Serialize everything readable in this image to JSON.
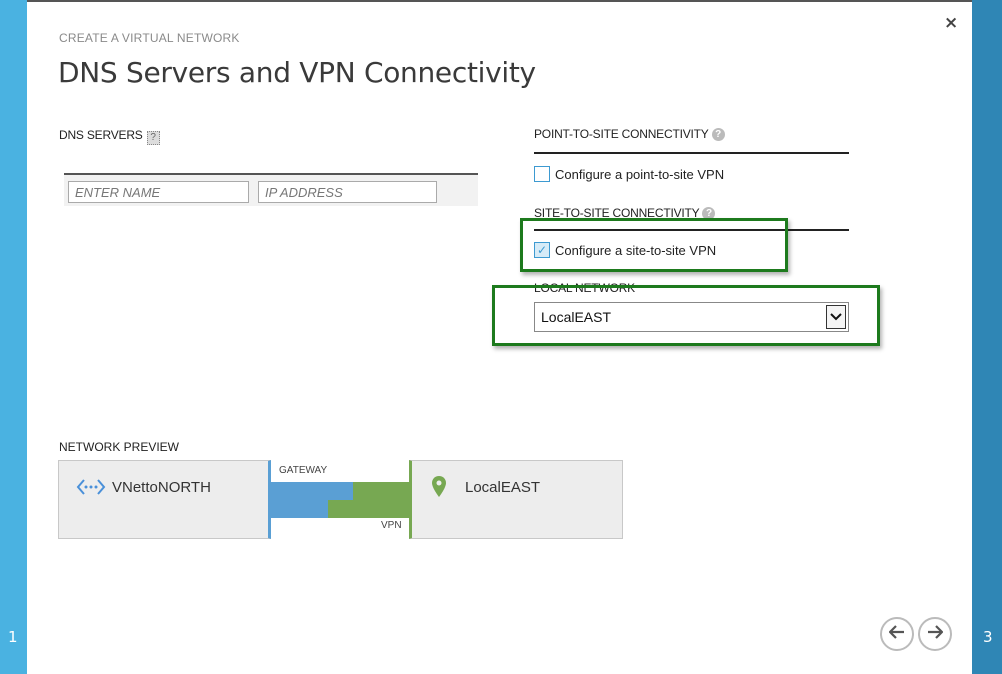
{
  "wizard": {
    "crumb": "CREATE A VIRTUAL NETWORK",
    "title": "DNS Servers and VPN Connectivity",
    "step_prev": "1",
    "step_next": "3",
    "close_glyph": "×"
  },
  "dns": {
    "label": "DNS SERVERS",
    "name_placeholder": "ENTER NAME",
    "ip_placeholder": "IP ADDRESS"
  },
  "p2s": {
    "label": "POINT-TO-SITE CONNECTIVITY",
    "checkbox_label": "Configure a point-to-site VPN",
    "checked": false
  },
  "s2s": {
    "label": "SITE-TO-SITE CONNECTIVITY",
    "checkbox_label": "Configure a site-to-site VPN",
    "checked": true
  },
  "local_network": {
    "label": "LOCAL NETWORK",
    "selected": "LocalEAST"
  },
  "preview": {
    "label": "NETWORK PREVIEW",
    "vnet_name": "VNettoNORTH",
    "gateway_label": "GATEWAY",
    "vpn_label": "VPN",
    "local_name": "LocalEAST"
  },
  "icons": {
    "vnet": "network-arrows-icon",
    "local": "map-pin-icon",
    "back": "arrow-left-icon",
    "next": "arrow-right-icon",
    "help": "help-icon"
  },
  "colors": {
    "rail_left": "#4ab2e1",
    "rail_right": "#2f86b5",
    "gateway_blue": "#5a9fd4",
    "vpn_green": "#77a852",
    "highlight": "#1d7a1d",
    "checkbox": "#3d9ad1"
  }
}
